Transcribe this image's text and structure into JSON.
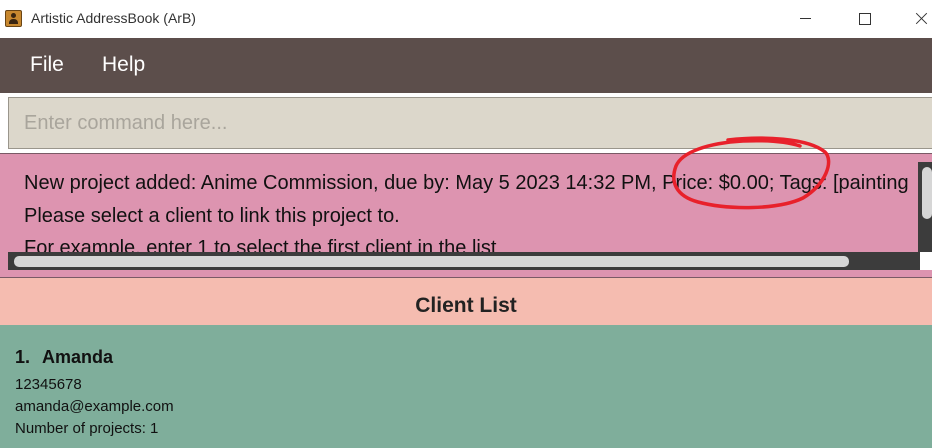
{
  "window": {
    "title": "Artistic AddressBook (ArB)",
    "icon": "address-book-icon"
  },
  "menu": {
    "items": [
      {
        "label": "File"
      },
      {
        "label": "Help"
      }
    ]
  },
  "command": {
    "placeholder": "Enter command here...",
    "value": ""
  },
  "result": {
    "lines": [
      "New project added: Anime Commission, due by: May 5 2023 14:32 PM, Price: $0.00; Tags: [painting",
      "Please select a client to link this project to.",
      "For example, enter 1 to select the first client in the list"
    ],
    "annotation_color": "#e8212b"
  },
  "client_list": {
    "header": "Client List",
    "clients": [
      {
        "index": "1.",
        "name": "Amanda",
        "phone": "12345678",
        "email": "amanda@example.com",
        "projects": "Number of projects: 1"
      }
    ]
  },
  "colors": {
    "menubar": "#5c4e4b",
    "command_bg": "#dcd7cb",
    "result_bg": "#dd94b0",
    "list_header_bg": "#f5bcb0",
    "list_bg": "#7fae9b"
  }
}
